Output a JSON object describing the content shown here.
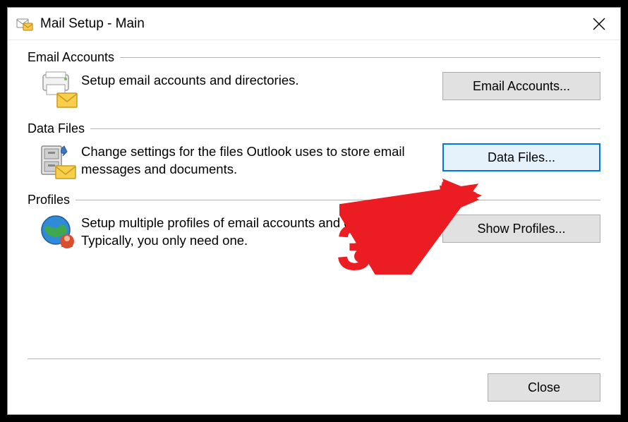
{
  "title": "Mail Setup - Main",
  "sections": {
    "email_accounts": {
      "heading": "Email Accounts",
      "description": "Setup email accounts and directories.",
      "button": "Email Accounts..."
    },
    "data_files": {
      "heading": "Data Files",
      "description": "Change settings for the files Outlook uses to store email messages and documents.",
      "button": "Data Files..."
    },
    "profiles": {
      "heading": "Profiles",
      "description": "Setup multiple profiles of email accounts and data files. Typically, you only need one.",
      "button": "Show Profiles..."
    }
  },
  "footer": {
    "close": "Close"
  },
  "annotation": {
    "number": "3"
  }
}
